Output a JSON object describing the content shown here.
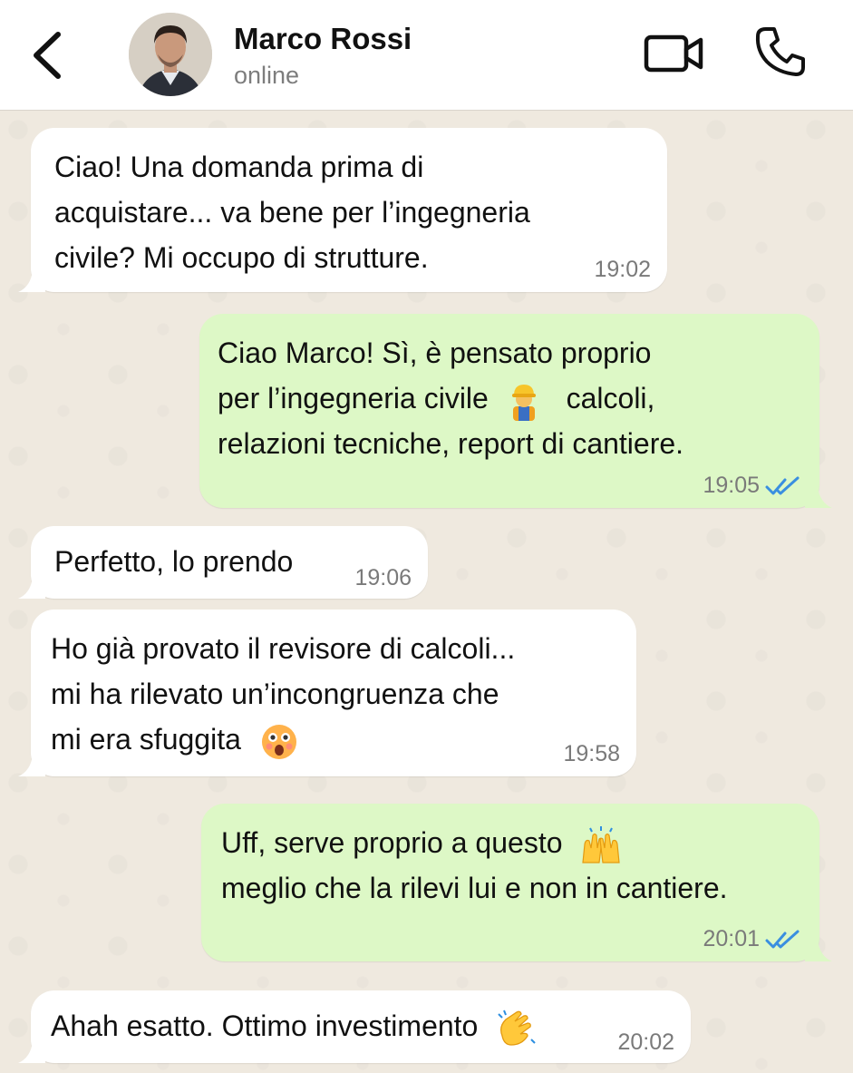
{
  "header": {
    "contact_name": "Marco Rossi",
    "status": "online"
  },
  "messages": [
    {
      "direction": "incoming",
      "lines": [
        "Ciao! Una domanda prima di",
        "acquistare... va bene per l’ingegneria",
        "civile? Mi occupo di strutture."
      ],
      "time": "19:02"
    },
    {
      "direction": "outgoing",
      "lines": [
        "Ciao Marco! Sì, è pensato proprio",
        "per l’ingegneria civile",
        "calcoli,",
        "relazioni tecniche, report di cantiere."
      ],
      "emoji": "construction-worker",
      "time": "19:05",
      "read": true
    },
    {
      "direction": "incoming",
      "lines": [
        "Perfetto, lo prendo"
      ],
      "time": "19:06"
    },
    {
      "direction": "incoming",
      "lines": [
        "Ho già provato il revisore di calcoli...",
        "mi ha rilevato un’incongruenza che",
        "mi era sfuggita"
      ],
      "emoji": "astonished-face",
      "time": "19:58"
    },
    {
      "direction": "outgoing",
      "lines": [
        "Uff, serve proprio a questo",
        "meglio che la rilevi lui e non in cantiere."
      ],
      "emoji": "raising-hands",
      "time": "20:01",
      "read": true
    },
    {
      "direction": "incoming",
      "lines": [
        "Ahah esatto. Ottimo investimento"
      ],
      "emoji": "clapping-hands",
      "time": "20:02"
    }
  ],
  "colors": {
    "incoming_bubble": "#ffffff",
    "outgoing_bubble": "#ddf8c6",
    "read_ticks": "#3a8fe0",
    "chat_background": "#efe9df"
  }
}
